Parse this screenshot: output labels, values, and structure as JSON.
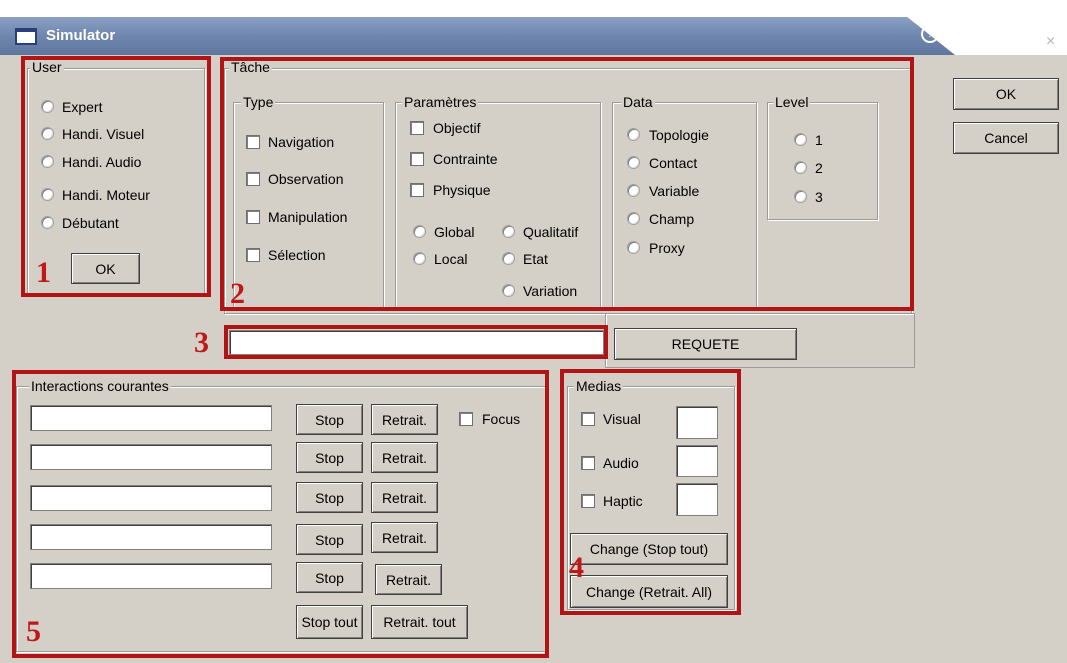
{
  "window": {
    "title": "Simulator",
    "help_symbol": "?",
    "close_symbol": "×"
  },
  "user": {
    "legend": "User",
    "options": [
      "Expert",
      "Handi. Visuel",
      "Handi. Audio",
      "Handi. Moteur",
      "Débutant"
    ],
    "ok": "OK",
    "marker": "1"
  },
  "tache": {
    "legend": "Tâche",
    "marker": "2",
    "type": {
      "legend": "Type",
      "options": [
        "Navigation",
        "Observation",
        "Manipulation",
        "Sélection"
      ]
    },
    "parametres": {
      "legend": "Paramètres",
      "checks": [
        "Objectif",
        "Contrainte",
        "Physique"
      ],
      "radios": [
        "Global",
        "Qualitatif",
        "Local",
        "Etat",
        "Variation"
      ]
    },
    "data": {
      "legend": "Data",
      "options": [
        "Topologie",
        "Contact",
        "Variable",
        "Champ",
        "Proxy"
      ]
    },
    "level": {
      "legend": "Level",
      "options": [
        "1",
        "2",
        "3"
      ]
    }
  },
  "dialog": {
    "ok": "OK",
    "cancel": "Cancel"
  },
  "requete": {
    "marker": "3",
    "value": "",
    "button": "REQUETE"
  },
  "interactions": {
    "legend": "Interactions courantes",
    "marker": "5",
    "stop": "Stop",
    "retrait": "Retrait.",
    "focus": "Focus",
    "stop_all": "Stop tout",
    "retrait_all": "Retrait. tout",
    "rows": [
      "",
      "",
      "",
      "",
      ""
    ]
  },
  "medias": {
    "legend": "Medias",
    "marker": "4",
    "items": [
      "Visual",
      "Audio",
      "Haptic"
    ],
    "change_stop": "Change (Stop tout)",
    "change_retrait": "Change (Retrait. All)"
  }
}
